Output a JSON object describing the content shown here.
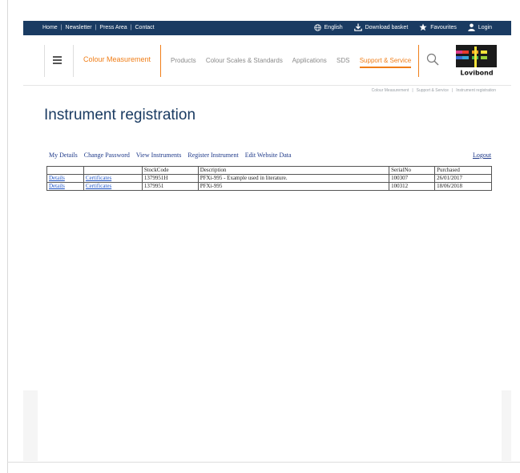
{
  "topbar": {
    "links": [
      "Home",
      "Newsletter",
      "Press Area",
      "Contact"
    ],
    "right": {
      "language": "English",
      "download": "Download basket",
      "favourites": "Favourites",
      "login": "Login"
    }
  },
  "header": {
    "brand": "Colour Measurement",
    "nav": [
      "Products",
      "Colour Scales & Standards",
      "Applications",
      "SDS",
      "Support & Service"
    ],
    "logo_text": "Lovibond"
  },
  "breadcrumb": [
    "Colour Measurement",
    "Support & Service",
    "Instrument registration"
  ],
  "page_title": "Instrument registration",
  "subnav": [
    "My Details",
    "Change Password",
    "View Instruments",
    "Register Instrument",
    "Edit Website Data"
  ],
  "logout": "Logout",
  "table": {
    "headers": [
      "",
      "",
      "StockCode",
      "Description",
      "SerialNo",
      "Purchased"
    ],
    "rows": [
      [
        "Details",
        "Certificates",
        "1379951H",
        "PFXi-995 - Example used in literature.",
        "100307",
        "26/01/2017"
      ],
      [
        "Details",
        "Certificates",
        "1379951",
        "PFXi-995",
        "100312",
        "18/06/2018"
      ]
    ]
  },
  "colors": {
    "topbar_bg": "#1a3b62",
    "accent": "#f07e18",
    "title": "#1a3b62",
    "link": "#1f55c8"
  }
}
